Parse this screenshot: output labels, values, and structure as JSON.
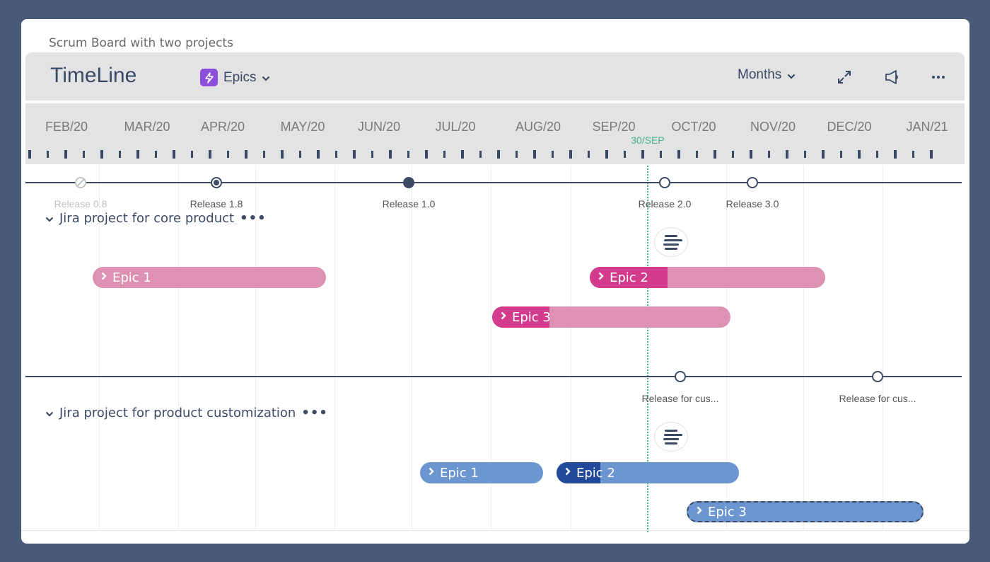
{
  "board_title": "Scrum Board with two projects",
  "header": {
    "title": "TimeLine",
    "issue_type": {
      "label": "Epics",
      "icon": "lightning-bolt-icon",
      "color": "#8b4fdc"
    },
    "zoom_level": "Months",
    "actions": [
      {
        "name": "fullscreen",
        "icon": "expand-arrows-icon"
      },
      {
        "name": "feedback",
        "icon": "megaphone-icon"
      },
      {
        "name": "more",
        "icon": "more-horizontal-icon"
      }
    ]
  },
  "scale": {
    "months": [
      "FEB/20",
      "MAR/20",
      "APR/20",
      "MAY/20",
      "JUN/20",
      "JUL/20",
      "AUG/20",
      "SEP/20",
      "OCT/20",
      "NOV/20",
      "DEC/20",
      "JAN/21"
    ],
    "today_label": "30/SEP",
    "today_color": "#46b38f"
  },
  "projects": [
    {
      "name": "Jira project for core product",
      "more": "•••",
      "releases": [
        {
          "label": "Release 0.8",
          "state": "archived"
        },
        {
          "label": "Release 1.8",
          "state": "current"
        },
        {
          "label": "Release 1.0",
          "state": "released"
        },
        {
          "label": "Release 2.0",
          "state": "unreleased"
        },
        {
          "label": "Release 3.0",
          "state": "unreleased"
        }
      ],
      "color": "#dd92b4",
      "progress_color": "#d33c8c",
      "epics": [
        {
          "label": "Epic 1",
          "progress": 0
        },
        {
          "label": "Epic 2",
          "progress": 0.33
        },
        {
          "label": "Epic 3",
          "progress": 0.24
        }
      ]
    },
    {
      "name": "Jira project for product customization",
      "more": "•••",
      "releases": [
        {
          "label": "Release for cus...",
          "state": "unreleased"
        },
        {
          "label": "Release for cus...",
          "state": "unreleased"
        }
      ],
      "color": "#6c96d0",
      "progress_color": "#234a9a",
      "epics": [
        {
          "label": "Epic 1",
          "progress": 0
        },
        {
          "label": "Epic 2",
          "progress": 0.24
        },
        {
          "label": "Epic 3",
          "progress": 0,
          "selected": true
        }
      ]
    }
  ]
}
